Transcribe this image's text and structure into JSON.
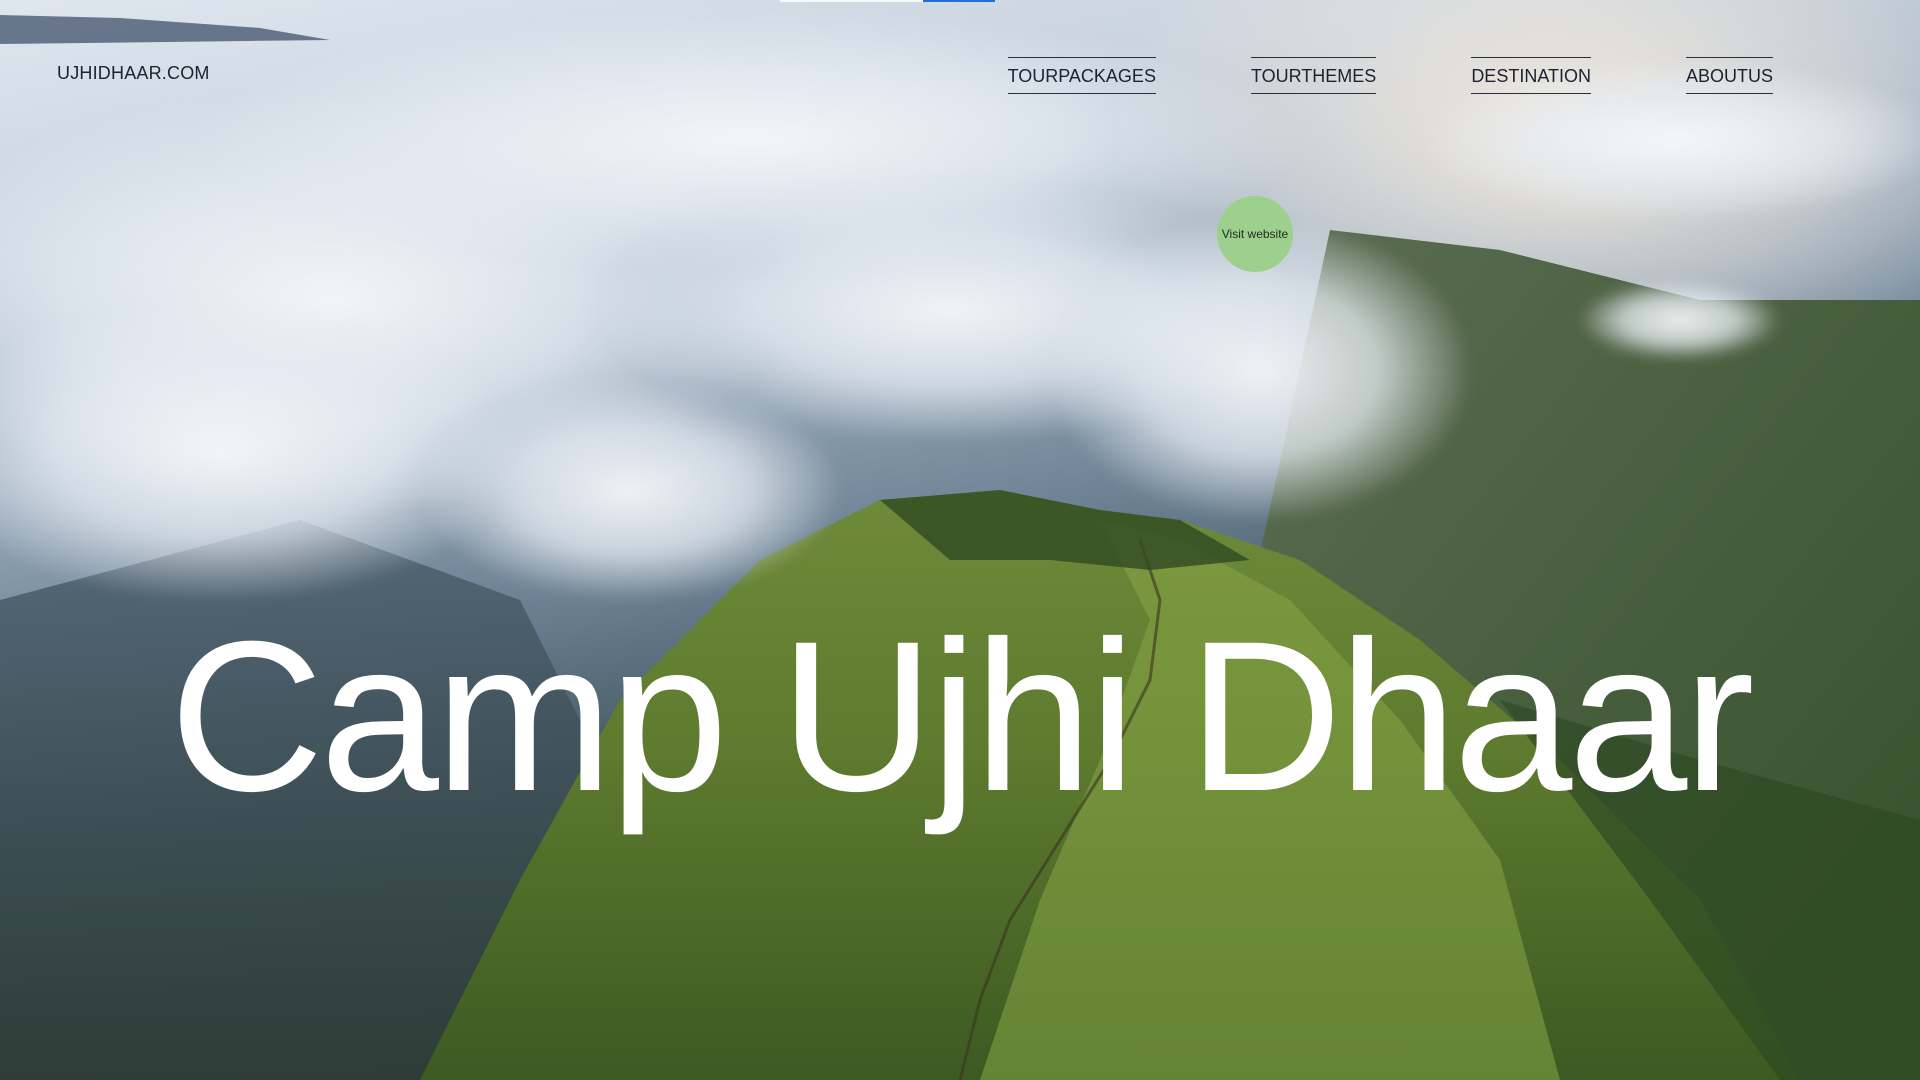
{
  "header": {
    "logo_text": "UJHIDHAAR.COM"
  },
  "nav": {
    "items": [
      {
        "label": "TOURPACKAGES"
      },
      {
        "label": "TOURTHEMES"
      },
      {
        "label": "DESTINATION"
      },
      {
        "label": "ABOUTUS"
      }
    ]
  },
  "visit_button": {
    "label": "Visit website",
    "color": "#9dd08c"
  },
  "hero": {
    "title": "Camp Ujhi Dhaar",
    "background": "aerial-mountain-ridge-above-clouds"
  },
  "colors": {
    "accent": "#1e6fd9",
    "text_dark": "#1c2330",
    "title_text": "#ffffff"
  }
}
